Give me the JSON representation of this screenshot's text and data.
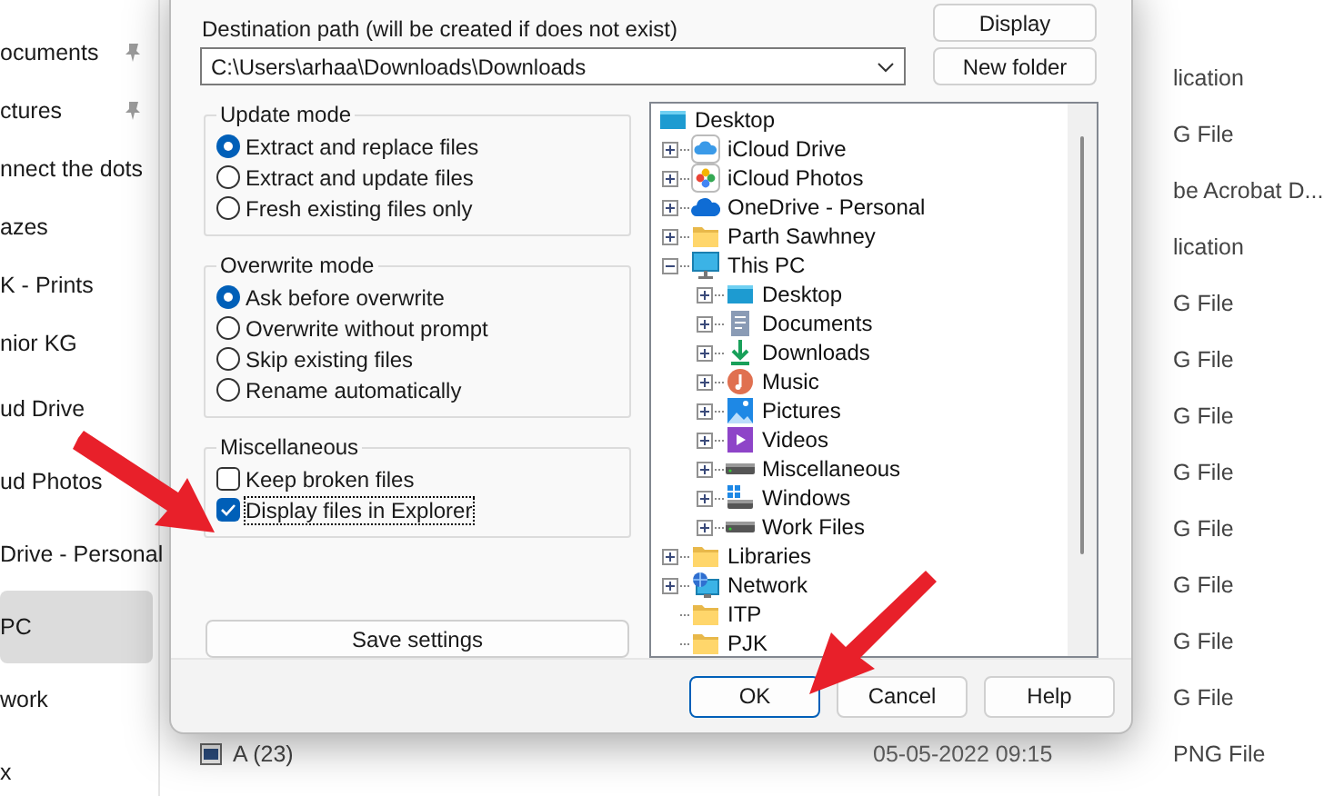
{
  "explorer": {
    "sidebar": {
      "sections": [
        {
          "items": [
            {
              "label": "ocuments",
              "pinned": true,
              "selected": false
            },
            {
              "label": "ctures",
              "pinned": true,
              "selected": false
            },
            {
              "label": "nnect the dots",
              "pinned": false,
              "selected": false
            },
            {
              "label": "azes",
              "pinned": false,
              "selected": false
            },
            {
              "label": "K - Prints",
              "pinned": false,
              "selected": false
            },
            {
              "label": "nior KG",
              "pinned": false,
              "selected": false
            }
          ]
        },
        {
          "items": [
            {
              "label": "ud Drive",
              "pinned": false,
              "selected": false
            },
            {
              "label": "ud Photos",
              "pinned": false,
              "selected": false
            },
            {
              "label": "Drive - Personal",
              "pinned": false,
              "selected": false
            },
            {
              "label": "PC",
              "pinned": false,
              "selected": true
            },
            {
              "label": "work",
              "pinned": false,
              "selected": false
            },
            {
              "label": "x",
              "pinned": false,
              "selected": false
            }
          ]
        }
      ]
    },
    "rows": [
      {
        "type": "lication"
      },
      {
        "type": "G File"
      },
      {
        "type": "be Acrobat D..."
      },
      {
        "type": "lication"
      },
      {
        "type": "G File"
      },
      {
        "type": "G File"
      },
      {
        "type": "G File"
      },
      {
        "type": "G File"
      },
      {
        "type": "G File"
      },
      {
        "type": "G File"
      },
      {
        "type": "G File"
      },
      {
        "type": "G File"
      },
      {
        "name": "A (23)",
        "modified": "05-05-2022 09:15",
        "type": "PNG File"
      }
    ]
  },
  "dialog": {
    "destination_label": "Destination path (will be created if does not exist)",
    "destination_path": "C:\\Users\\arhaa\\Downloads\\Downloads",
    "display_button": "Display",
    "new_folder_button": "New folder",
    "update_mode": {
      "title": "Update mode",
      "options": [
        {
          "label": "Extract and replace files",
          "selected": true
        },
        {
          "label": "Extract and update files",
          "selected": false
        },
        {
          "label": "Fresh existing files only",
          "selected": false
        }
      ]
    },
    "overwrite_mode": {
      "title": "Overwrite mode",
      "options": [
        {
          "label": "Ask before overwrite",
          "selected": true
        },
        {
          "label": "Overwrite without prompt",
          "selected": false
        },
        {
          "label": "Skip existing files",
          "selected": false
        },
        {
          "label": "Rename automatically",
          "selected": false
        }
      ]
    },
    "miscellaneous": {
      "title": "Miscellaneous",
      "options": [
        {
          "label": "Keep broken files",
          "checked": false,
          "focused": false
        },
        {
          "label": "Display files in Explorer",
          "checked": true,
          "focused": true
        }
      ]
    },
    "save_settings_button": "Save settings",
    "tree": [
      {
        "label": "Desktop",
        "kind": "desktop",
        "expandable": false,
        "children": [
          {
            "label": "iCloud Drive",
            "kind": "icloud",
            "expandable": true,
            "expanded": false
          },
          {
            "label": "iCloud Photos",
            "kind": "photos",
            "expandable": true,
            "expanded": false
          },
          {
            "label": "OneDrive - Personal",
            "kind": "onedrive",
            "expandable": true,
            "expanded": false
          },
          {
            "label": "Parth Sawhney",
            "kind": "folder",
            "expandable": true,
            "expanded": false
          },
          {
            "label": "This PC",
            "kind": "pc",
            "expandable": true,
            "expanded": true,
            "children": [
              {
                "label": "Desktop",
                "kind": "desktop",
                "expandable": true,
                "expanded": false
              },
              {
                "label": "Documents",
                "kind": "documents",
                "expandable": true,
                "expanded": false
              },
              {
                "label": "Downloads",
                "kind": "downloads",
                "expandable": true,
                "expanded": false
              },
              {
                "label": "Music",
                "kind": "music",
                "expandable": true,
                "expanded": false
              },
              {
                "label": "Pictures",
                "kind": "pictures",
                "expandable": true,
                "expanded": false
              },
              {
                "label": "Videos",
                "kind": "videos",
                "expandable": true,
                "expanded": false
              },
              {
                "label": "Miscellaneous",
                "kind": "drive",
                "expandable": true,
                "expanded": false
              },
              {
                "label": "Windows",
                "kind": "windows-drive",
                "expandable": true,
                "expanded": false
              },
              {
                "label": "Work Files",
                "kind": "drive",
                "expandable": true,
                "expanded": false
              }
            ]
          },
          {
            "label": "Libraries",
            "kind": "folder",
            "expandable": true,
            "expanded": false
          },
          {
            "label": "Network",
            "kind": "network",
            "expandable": true,
            "expanded": false
          },
          {
            "label": "ITP",
            "kind": "folder",
            "expandable": false
          },
          {
            "label": "PJK",
            "kind": "folder",
            "expandable": false
          }
        ]
      }
    ],
    "buttons": [
      {
        "label": "OK",
        "default": true
      },
      {
        "label": "Cancel",
        "default": false
      },
      {
        "label": "Help",
        "default": false
      }
    ]
  }
}
